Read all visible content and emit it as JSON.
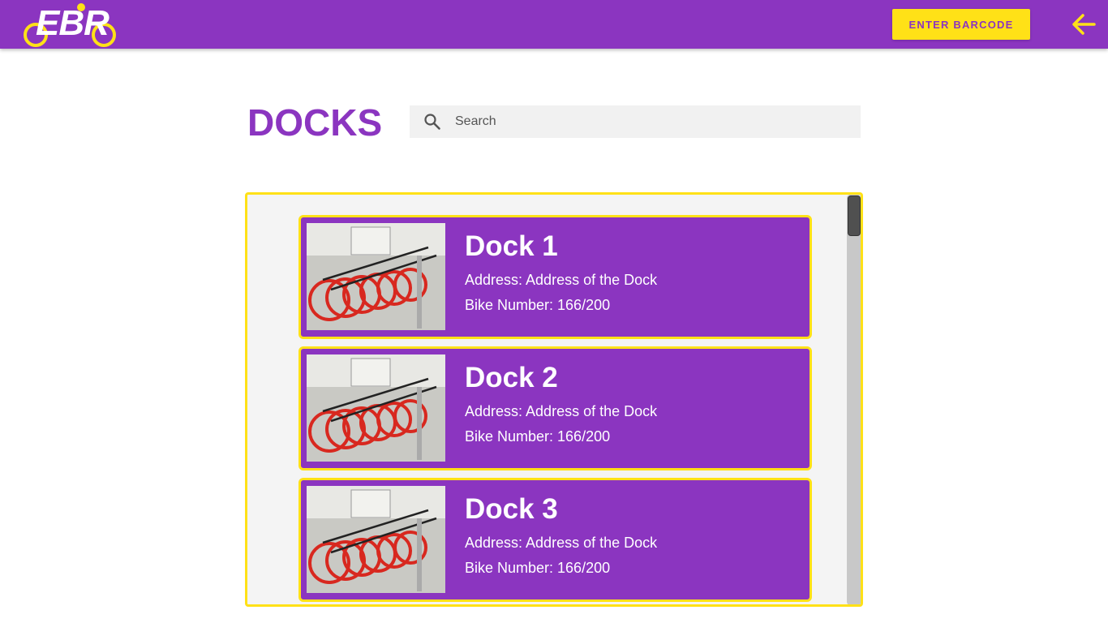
{
  "app": {
    "logo_text": "EBR",
    "enter_barcode_label": "ENTER BARCODE",
    "back_icon": "arrow-left-icon"
  },
  "page": {
    "title": "DOCKS",
    "search_placeholder": "Search"
  },
  "docks": [
    {
      "name": "Dock 1",
      "address": "Address: Address of the Dock",
      "bikes": "Bike Number: 166/200"
    },
    {
      "name": "Dock 2",
      "address": "Address: Address of the Dock",
      "bikes": "Bike Number: 166/200"
    },
    {
      "name": "Dock 3",
      "address": "Address: Address of the Dock",
      "bikes": "Bike Number: 166/200"
    }
  ],
  "colors": {
    "primary": "#8b35c0",
    "accent": "#ffe117",
    "panel_background": "#f4f4f4"
  }
}
